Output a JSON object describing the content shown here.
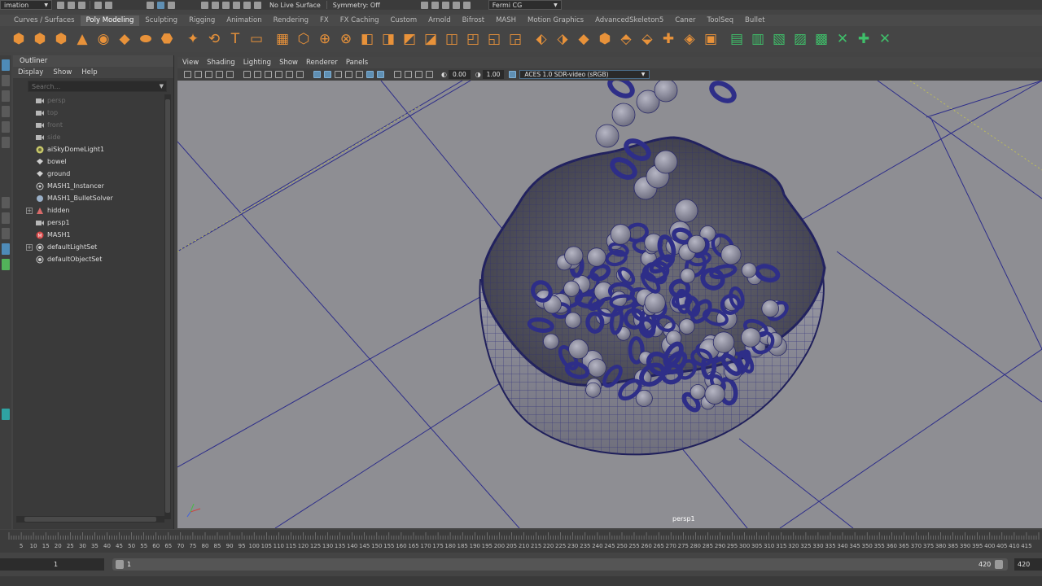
{
  "statusline": {
    "mode": "imation",
    "live_surface": "No Live Surface",
    "symmetry": "Symmetry: Off",
    "renderer": "Fermi CG"
  },
  "shelf_tabs": [
    {
      "label": "Curves / Surfaces"
    },
    {
      "label": "Poly Modeling",
      "active": true
    },
    {
      "label": "Sculpting"
    },
    {
      "label": "Rigging"
    },
    {
      "label": "Animation"
    },
    {
      "label": "Rendering"
    },
    {
      "label": "FX"
    },
    {
      "label": "FX Caching"
    },
    {
      "label": "Custom"
    },
    {
      "label": "Arnold"
    },
    {
      "label": "Bifrost"
    },
    {
      "label": "MASH"
    },
    {
      "label": "Motion Graphics"
    },
    {
      "label": "AdvancedSkeleton5"
    },
    {
      "label": "Caner"
    },
    {
      "label": "ToolSeq"
    },
    {
      "label": "Bullet"
    }
  ],
  "outliner": {
    "title": "Outliner",
    "menu": [
      "Display",
      "Show",
      "Help"
    ],
    "search_placeholder": "Search...",
    "items": [
      {
        "label": "persp",
        "icon": "camera-icon",
        "dim": true
      },
      {
        "label": "top",
        "icon": "camera-icon",
        "dim": true
      },
      {
        "label": "front",
        "icon": "camera-icon",
        "dim": true
      },
      {
        "label": "side",
        "icon": "camera-icon",
        "dim": true
      },
      {
        "label": "aiSkyDomeLight1",
        "icon": "skydome-light-icon"
      },
      {
        "label": "bowel",
        "icon": "mesh-icon"
      },
      {
        "label": "ground",
        "icon": "mesh-icon"
      },
      {
        "label": "MASH1_Instancer",
        "icon": "instancer-icon"
      },
      {
        "label": "MASH1_BulletSolver",
        "icon": "solver-icon"
      },
      {
        "label": "hidden",
        "icon": "group-icon",
        "expandable": true
      },
      {
        "label": "persp1",
        "icon": "camera-icon"
      },
      {
        "label": "MASH1",
        "icon": "mash-network-icon"
      },
      {
        "label": "defaultLightSet",
        "icon": "set-icon",
        "expandable": true
      },
      {
        "label": "defaultObjectSet",
        "icon": "set-icon"
      }
    ]
  },
  "viewport": {
    "menu": [
      "View",
      "Shading",
      "Lighting",
      "Show",
      "Renderer",
      "Panels"
    ],
    "gamma_value": "0.00",
    "exposure_value": "1.00",
    "color_management": "ACES 1.0 SDR-video (sRGB)",
    "camera_label": "persp1"
  },
  "timeline": {
    "ticks": [
      "5",
      "10",
      "15",
      "20",
      "25",
      "30",
      "35",
      "40",
      "45",
      "50",
      "55",
      "60",
      "65",
      "70",
      "75",
      "80",
      "85",
      "90",
      "95",
      "100",
      "105",
      "110",
      "115",
      "120",
      "125",
      "130",
      "135",
      "140",
      "145",
      "150",
      "155",
      "160",
      "165",
      "170",
      "175",
      "180",
      "185",
      "190",
      "195",
      "200",
      "205",
      "210",
      "215",
      "220",
      "225",
      "230",
      "235",
      "240",
      "245",
      "250",
      "255",
      "260",
      "265",
      "270",
      "275",
      "280",
      "285",
      "290",
      "295",
      "300",
      "305",
      "310",
      "315",
      "320",
      "325",
      "330",
      "335",
      "340",
      "345",
      "350",
      "355",
      "360",
      "365",
      "370",
      "375",
      "380",
      "385",
      "390",
      "395",
      "400",
      "405",
      "410",
      "415"
    ],
    "start_frame": "1",
    "range_start": "1",
    "range_end": "420",
    "end_frame": "420"
  },
  "colors": {
    "shelf_icon": "#e8923a",
    "shelf_icon_green": "#3fbf6a",
    "viewport_bg": "#8e8e93",
    "wire": "#2b2b7a",
    "highlight_blue": "#5f8fb3"
  }
}
